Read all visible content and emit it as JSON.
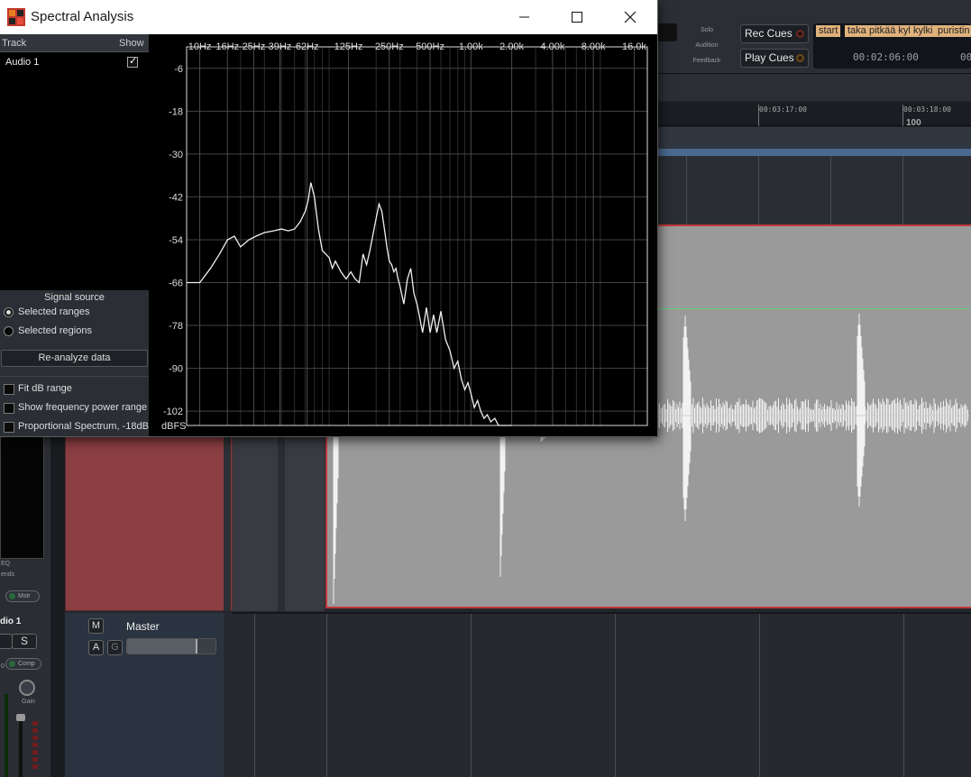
{
  "window": {
    "title": "Spectral Analysis",
    "controls": [
      "minimize",
      "maximize",
      "close"
    ]
  },
  "sidebar": {
    "header_track": "Track",
    "header_show": "Show",
    "tracks": [
      {
        "name": "Audio 1",
        "shown": true
      }
    ],
    "signal_source_title": "Signal source",
    "sources": [
      {
        "label": "Selected ranges",
        "selected": true
      },
      {
        "label": "Selected regions",
        "selected": false
      }
    ],
    "reanalyze_label": "Re-analyze data",
    "options": [
      {
        "label": "Fit dB range",
        "checked": false
      },
      {
        "label": "Show frequency power range",
        "checked": false
      },
      {
        "label": "Proportional Spectrum, -18dB",
        "checked": false
      }
    ]
  },
  "chart_data": {
    "type": "line",
    "title": "",
    "xlabel": "",
    "ylabel": "dBFS",
    "x_scale": "log",
    "x_ticks": [
      "10Hz",
      "16Hz",
      "25Hz",
      "39Hz",
      "62Hz",
      "125Hz",
      "250Hz",
      "500Hz",
      "1.00k",
      "2.00k",
      "4.00k",
      "8.00k",
      "16.0k"
    ],
    "y_ticks": [
      -6,
      -18,
      -30,
      -42,
      -54,
      -66,
      -78,
      -90,
      -102
    ],
    "ylim": [
      -106,
      0
    ],
    "xlim": [
      8,
      20000
    ],
    "grid": true,
    "series": [
      {
        "x": [
          8,
          10,
          12,
          14,
          16,
          18,
          20,
          23,
          26,
          30,
          35,
          40,
          45,
          50,
          55,
          60,
          63,
          66,
          70,
          75,
          80,
          85,
          90,
          95,
          100,
          110,
          120,
          130,
          140,
          150,
          160,
          170,
          180,
          200,
          210,
          220,
          230,
          240,
          250,
          260,
          270,
          280,
          290,
          300,
          320,
          340,
          360,
          380,
          400,
          420,
          440,
          470,
          500,
          530,
          560,
          600,
          650,
          700,
          750,
          800,
          850,
          900,
          950,
          1000,
          1060,
          1120,
          1180,
          1250,
          1320,
          1400,
          1500,
          1600,
          1700,
          1800,
          1900,
          2000
        ],
        "y": [
          -66,
          -66,
          -62,
          -58,
          -54,
          -53,
          -56,
          -54,
          -53,
          -52,
          -51.5,
          -51,
          -51.5,
          -51,
          -49,
          -46,
          -43,
          -38,
          -42,
          -51,
          -57,
          -58,
          -59,
          -62,
          -60,
          -63,
          -65,
          -63,
          -65,
          -66,
          -58,
          -61,
          -57,
          -48,
          -44,
          -46,
          -51,
          -56,
          -60,
          -61,
          -63,
          -62,
          -65,
          -67,
          -72,
          -65,
          -62,
          -69,
          -72,
          -76,
          -80,
          -73,
          -80,
          -75,
          -80,
          -74,
          -82,
          -85,
          -90,
          -88,
          -93,
          -96,
          -94,
          -97,
          -101,
          -99,
          -102,
          -104,
          -103,
          -105,
          -104,
          -106,
          -106,
          -106,
          -106,
          -106
        ]
      }
    ]
  },
  "daw": {
    "monitor_buttons": [
      "Solo",
      "Audition",
      "Feedback"
    ],
    "rec_cues_label": "Rec Cues",
    "play_cues_label": "Play Cues",
    "markers": [
      "start",
      "taka",
      "pitkää kyl",
      "kylki",
      "puristin"
    ],
    "marker_time": "00:02:06:00",
    "marker_time2": "00",
    "timeline_labels": [
      "00:03:17:00",
      "00:03:18:00"
    ],
    "timeline_number": "100",
    "strip": {
      "eq_label": "EQ",
      "sends_label": "ends",
      "monitor_label": "Mstr",
      "track_name": "dio 1",
      "solo_label": "S",
      "comp_label": "Comp",
      "gain_label": "Gain",
      "zero_label": "0"
    },
    "master": {
      "name": "Master",
      "mute": "M",
      "a": "A",
      "g": "G"
    }
  }
}
